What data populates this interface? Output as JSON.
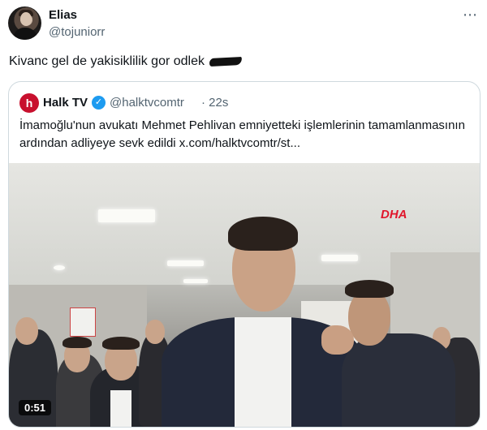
{
  "author": {
    "name": "Elias",
    "handle": "@tojuniorr"
  },
  "tweet": {
    "text": "Kivanc gel de yakisiklilik gor odlek"
  },
  "more_icon": "⋯",
  "quoted": {
    "avatar_letter": "h",
    "name": "Halk TV",
    "verified_icon": "✓",
    "handle": "@halktvcomtr",
    "time": "· 22s",
    "text": "İmamoğlu'nun avukatı Mehmet Pehlivan emniyetteki işlemlerinin tamamlanmasının ardından adliyeye sevk edildi  x.com/halktvcomtr/st...",
    "media": {
      "watermark": "DHA",
      "duration": "0:51"
    }
  },
  "colors": {
    "accent": "#1d9bf0",
    "brand": "#c8102e",
    "muted": "#536471",
    "text": "#0f1419",
    "border": "#cfd9de"
  }
}
